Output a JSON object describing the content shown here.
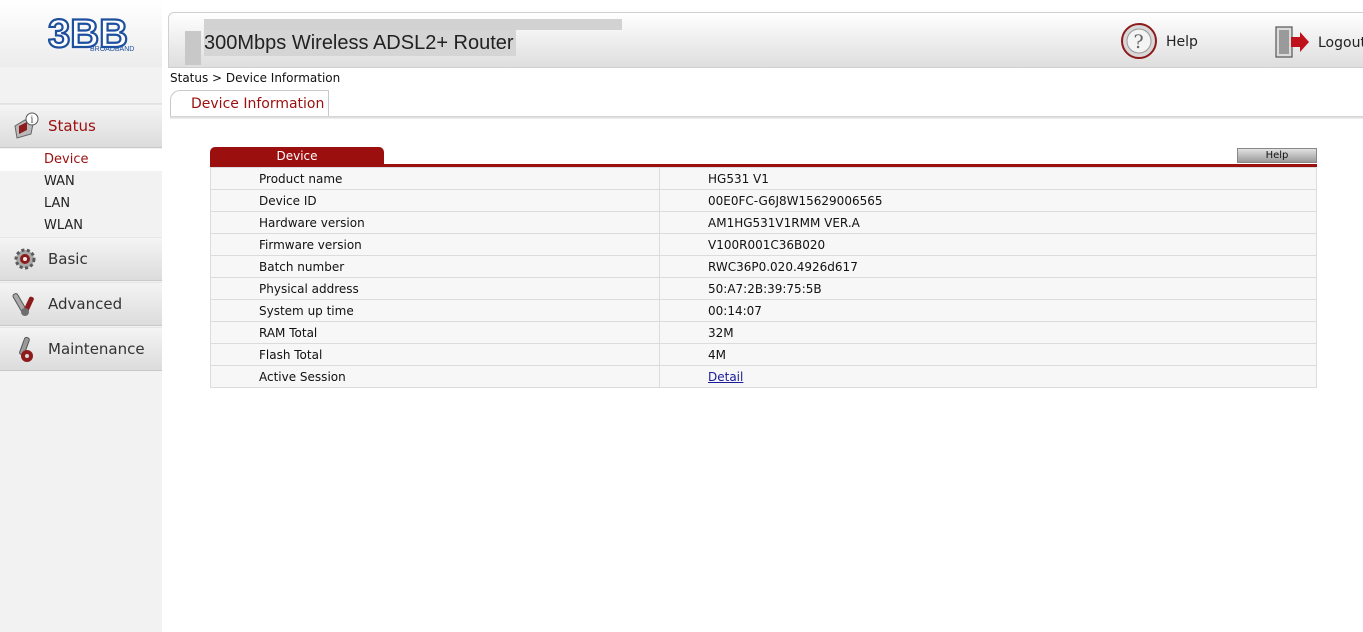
{
  "brand": {
    "logo_text": "3BB",
    "logo_subtext": "BROADBAND"
  },
  "header": {
    "title": "300Mbps Wireless ADSL2+ Router",
    "help_label": "Help",
    "logout_label": "Logout"
  },
  "breadcrumb": "Status > Device Information",
  "tabs": [
    {
      "label": "Device Information",
      "active": true
    }
  ],
  "sidebar": {
    "sections": [
      {
        "label": "Status",
        "icon": "status-icon",
        "active": true,
        "items": [
          {
            "label": "Device",
            "active": true
          },
          {
            "label": "WAN"
          },
          {
            "label": "LAN"
          },
          {
            "label": "WLAN"
          }
        ]
      },
      {
        "label": "Basic",
        "icon": "gear-icon"
      },
      {
        "label": "Advanced",
        "icon": "tools-icon"
      },
      {
        "label": "Maintenance",
        "icon": "wrench-icon"
      }
    ]
  },
  "panel": {
    "title": "Device",
    "help_label": "Help",
    "rows": [
      {
        "label": "Product name",
        "value": "HG531 V1"
      },
      {
        "label": "Device ID",
        "value": "00E0FC-G6J8W15629006565"
      },
      {
        "label": "Hardware version",
        "value": "AM1HG531V1RMM VER.A"
      },
      {
        "label": "Firmware version",
        "value": "V100R001C36B020"
      },
      {
        "label": "Batch number",
        "value": "RWC36P0.020.4926d617"
      },
      {
        "label": "Physical address",
        "value": "50:A7:2B:39:75:5B"
      },
      {
        "label": "System up time",
        "value": "00:14:07"
      },
      {
        "label": "RAM Total",
        "value": "32M"
      },
      {
        "label": "Flash Total",
        "value": "4M"
      },
      {
        "label": "Active Session",
        "value": "Detail",
        "is_link": true
      }
    ]
  },
  "colors": {
    "accent": "#9b0f0f",
    "link": "#1a1a9a"
  }
}
